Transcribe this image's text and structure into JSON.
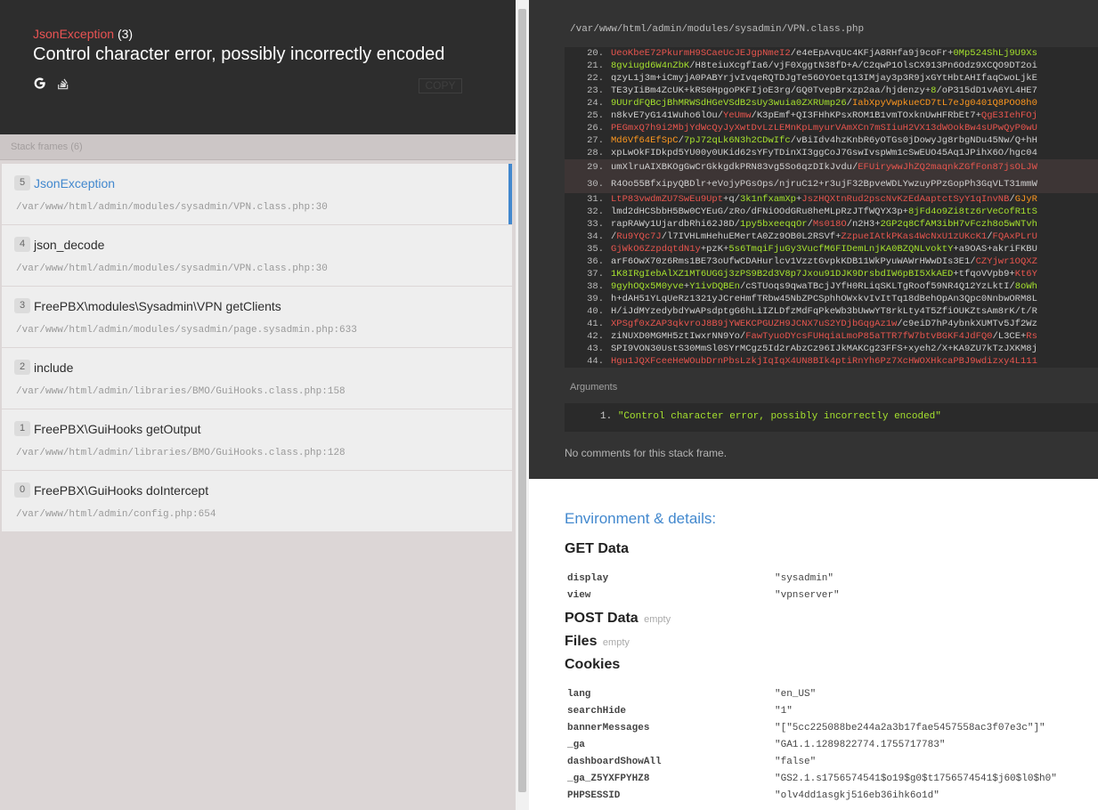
{
  "exception": {
    "name": "JsonException",
    "count": "(3)",
    "message": "Control character error, possibly incorrectly encoded",
    "copy_label": "COPY",
    "icons": [
      "google-icon",
      "stackoverflow-icon"
    ]
  },
  "frames_title": "Stack frames (6)",
  "frames": [
    {
      "index": "5",
      "name": "JsonException",
      "file": "/var/www/html/admin/modules/sysadmin/VPN.class.php:30"
    },
    {
      "index": "4",
      "name": "json_decode",
      "file": "/var/www/html/admin/modules/sysadmin/VPN.class.php:30"
    },
    {
      "index": "3",
      "name": "FreePBX\\modules\\Sysadmin\\VPN getClients",
      "file": "/var/www/html/admin/modules/sysadmin/page.sysadmin.php:633"
    },
    {
      "index": "2",
      "name": "include",
      "file": "/var/www/html/admin/libraries/BMO/GuiHooks.class.php:158"
    },
    {
      "index": "1",
      "name": "FreePBX\\GuiHooks getOutput",
      "file": "/var/www/html/admin/libraries/BMO/GuiHooks.class.php:128"
    },
    {
      "index": "0",
      "name": "FreePBX\\GuiHooks doIntercept",
      "file": "/var/www/html/admin/config.php:654"
    }
  ],
  "code": {
    "file_path": "/var/www/html/admin/modules/sysadmin/VPN.class.php",
    "lines": [
      {
        "n": "20.",
        "segs": [
          [
            "r",
            "UeoKbeE72PkurmH9SCaeUcJEJgpNmeI2"
          ],
          [
            "w",
            "/e4eEpAvqUc4KFjA8RHfa9j9coFr+"
          ],
          [
            "g",
            "0Mp524ShLj9U9Xs"
          ]
        ]
      },
      {
        "n": "21.",
        "segs": [
          [
            "g",
            "8gviugd6W4nZbK"
          ],
          [
            "w",
            "/H8teiuXcgfIa6/vjF0XggtN38fD+A/C2qwP1OlsCX913Pn6Odz9XCQO9DT2oi"
          ]
        ]
      },
      {
        "n": "22.",
        "segs": [
          [
            "w",
            "qzyL1j3m+iCmyjA0PABYrjvIvqeRQTDJgTe56OYOetq13IMjay3p3R9jxGYtHbtAHIfaqCwoLjkE"
          ]
        ]
      },
      {
        "n": "23.",
        "segs": [
          [
            "w",
            "TE3yIiBm4ZcUK+kRS0HpgoPKFIjoE3rg/GQ0TvepBrxzp2aa/hjdenzy+"
          ],
          [
            "g",
            "8"
          ],
          [
            "w",
            "/oP315dD1vA6YL4HE7"
          ]
        ]
      },
      {
        "n": "24.",
        "segs": [
          [
            "g",
            "9UUrdFQBcjBhMRWSdHGeVSdB2sUy3wuia0ZXRUmp26"
          ],
          [
            "w",
            "/"
          ],
          [
            "o",
            "IabXpyVwpkueCD7tL7eJg0401Q8POO8h0"
          ]
        ]
      },
      {
        "n": "25.",
        "segs": [
          [
            "w",
            "n8kvE7yG141Wuho6lOu/"
          ],
          [
            "r",
            "YeUmw"
          ],
          [
            "w",
            "/K3pEmf+QI3FHhKPsxROM1B1vmTOxknUwHFRbEt7+"
          ],
          [
            "r",
            "QgE3IehFOj"
          ]
        ]
      },
      {
        "n": "26.",
        "segs": [
          [
            "r",
            "PEGmxQ7h9i2MbjYdWcQyJyXwtDvLzLEMnKpLmyurVAmXCn7mSIiuH2VX13dWOokBw4sUPwQyP0wU"
          ]
        ]
      },
      {
        "n": "27.",
        "segs": [
          [
            "o",
            "Md6Vf64EfSpC"
          ],
          [
            "w",
            "/"
          ],
          [
            "g",
            "7pJ72qLk6N3h2CDwIfc"
          ],
          [
            "w",
            "/vBiIdv4hzKnbR6yOTGs0jDowyJg8rbgNDu45Nw/Q+hH"
          ]
        ]
      },
      {
        "n": "28.",
        "segs": [
          [
            "w",
            "xpLwOkFIDkpd5YU00y0UKid62sYFyTDinXI3ggCoJ7GswIvspWm1cSwEUO45Aq1JPihX6O/hgc04"
          ]
        ]
      },
      {
        "n": "29.",
        "hl": true,
        "segs": [
          [
            "w",
            "umXlruAIXBKOgGwCrGkkgdkPRN83vg5So6qzDIkJvdu/"
          ],
          [
            "r",
            "EFUirywwJhZQ2maqnkZGfFon87jsOLJW"
          ]
        ]
      },
      {
        "n": "30.",
        "hl": true,
        "segs": [
          [
            "w",
            "R4Oo55BfxipyQBDlr+eVojyPGsOps/njruC12+r3ujF32BpveWDLYwzuyPPzGopPh3GqVLT31mmW"
          ]
        ]
      },
      {
        "n": "31.",
        "segs": [
          [
            "r",
            "LtP83vwdmZU7SwEu9Upt"
          ],
          [
            "w",
            "+q/"
          ],
          [
            "g",
            "3k1nfxamXp"
          ],
          [
            "w",
            "+"
          ],
          [
            "r",
            "JszHQXtnRud2pscNvKzEdAaptctSyY1qInvNB"
          ],
          [
            "w",
            "/"
          ],
          [
            "o",
            "GJyR"
          ]
        ]
      },
      {
        "n": "32.",
        "segs": [
          [
            "w",
            "lmd2dHCSbbH5Bw0CYEuG/zRo/dFNiOOdGRu8heMLpRzJTfWQYX3p+"
          ],
          [
            "g",
            "8jFd4o9Zi8tz6rVeCofR1tS"
          ]
        ]
      },
      {
        "n": "33.",
        "segs": [
          [
            "w",
            "rapRAWy1UjardbRhi62J8D/"
          ],
          [
            "g",
            "1py5bxeeqqOr"
          ],
          [
            "w",
            "/"
          ],
          [
            "r",
            "Ms018O"
          ],
          [
            "w",
            "/n2H3+"
          ],
          [
            "g",
            "2GP2q8CfAM3ibH7vFczh8o5wNTvh"
          ]
        ]
      },
      {
        "n": "34.",
        "segs": [
          [
            "w",
            "/"
          ],
          [
            "r",
            "Ru9YQc7J"
          ],
          [
            "w",
            "/l7IVHLmHehuEMertA0Zz9OB0L2RSVf+"
          ],
          [
            "r",
            "ZzpueIAtkPKas4WcNxU1zUKcK1"
          ],
          [
            "w",
            "/"
          ],
          [
            "r",
            "FQAxPLrU"
          ]
        ]
      },
      {
        "n": "35.",
        "segs": [
          [
            "r",
            "GjWkO6ZzpdqtdN1y"
          ],
          [
            "w",
            "+pzK+"
          ],
          [
            "g",
            "5s6TmqiFjuGy3VucfM6FIDemLnjKA0BZQNLvoktY"
          ],
          [
            "w",
            "+a9OAS+akriFKBU"
          ]
        ]
      },
      {
        "n": "36.",
        "segs": [
          [
            "w",
            "arF6OwX70z6Rms1BE73oUfwCDAHurlcv1VzztGvpkKDB11WkPyuWAWrHWwDIs3E1/"
          ],
          [
            "r",
            "CZYjwr1OQXZ"
          ]
        ]
      },
      {
        "n": "37.",
        "segs": [
          [
            "g",
            "1K8IRgIebAlXZ1MT6UGGj3zPS9B2d3V8p7Jxou91DJK9DrsbdIW6pBI5XkAED"
          ],
          [
            "w",
            "+tfqoVVpb9+"
          ],
          [
            "r",
            "Kt6Y"
          ]
        ]
      },
      {
        "n": "38.",
        "segs": [
          [
            "g",
            "9gyhOQx5M0yve"
          ],
          [
            "w",
            "+"
          ],
          [
            "g",
            "Y1ivDQBEn"
          ],
          [
            "w",
            "/cSTUoqs9qwaTBcjJYfH0RLiqSKLTgRoof59NR4Q12YzLktI/"
          ],
          [
            "g",
            "8oWh"
          ]
        ]
      },
      {
        "n": "39.",
        "segs": [
          [
            "w",
            "h+dAH51YLqUeRz1321yJCreHmfTRbw45NbZPCSphhOWxkvIvItTq18dBehOpAn3Qpc0NnbwORM8L"
          ]
        ]
      },
      {
        "n": "40.",
        "segs": [
          [
            "w",
            "H/iJdMYzedybdYwAPsdptgG6hLiIZLDfzMdFqPkeWb3bUwwYT8rkLty4T5ZfiOUKZtsAm8rK/t/R"
          ]
        ]
      },
      {
        "n": "41.",
        "segs": [
          [
            "r",
            "XPSgf0xZAP3qkvroJ8B9jYWEKCPGUZH9JCNX7uS2YDjbGqgAz1w"
          ],
          [
            "w",
            "/c9eiD7hP4ybnkXUMTv5Jf2Wz"
          ]
        ]
      },
      {
        "n": "42.",
        "segs": [
          [
            "w",
            "ziNUXD0MGMH5ztIwxrNN9Yo/"
          ],
          [
            "r",
            "FawTyuoDYcsFUHqiaLmoP85aTTR7fW7btvBGKF4JdFQ0"
          ],
          [
            "w",
            "/L3CE+"
          ],
          [
            "r",
            "Rs"
          ]
        ]
      },
      {
        "n": "43.",
        "segs": [
          [
            "w",
            "SPI9VON30UstS30MmSl0SYrMCgz5Id2rAbzCz96IJkMAKCg23FFS+xyeh2/X+KA9ZU7kTzJXKM8j"
          ]
        ]
      },
      {
        "n": "44.",
        "segs": [
          [
            "r",
            "Hgu1JQXFceeHeWOubDrnPbsLzkjIqIqX4UN8BIk4ptiRnYh6Pz7XcHWOXHkcaPBJ9wdizxy4L111"
          ]
        ]
      }
    ]
  },
  "arguments_title": "Arguments",
  "arguments": [
    {
      "index": "1.",
      "value": "\"Control character error, possibly incorrectly encoded\""
    }
  ],
  "comments": "No comments for this stack frame.",
  "env": {
    "title": "Environment & details:",
    "get_title": "GET Data",
    "get": [
      {
        "k": "display",
        "v": "\"sysadmin\""
      },
      {
        "k": "view",
        "v": "\"vpnserver\""
      }
    ],
    "post_title": "POST Data",
    "post_empty": "empty",
    "files_title": "Files",
    "files_empty": "empty",
    "cookies_title": "Cookies",
    "cookies": [
      {
        "k": "lang",
        "v": "\"en_US\""
      },
      {
        "k": "searchHide",
        "v": "\"1\""
      },
      {
        "k": "bannerMessages",
        "v": "\"[\"5cc225088be244a2a3b17fae5457558ac3f07e3c\"]\""
      },
      {
        "k": "_ga",
        "v": "\"GA1.1.1289822774.1755717783\""
      },
      {
        "k": "dashboardShowAll",
        "v": "\"false\""
      },
      {
        "k": "_ga_Z5YXFPYHZ8",
        "v": "\"GS2.1.s1756574541$o19$g0$t1756574541$j60$l0$h0\""
      },
      {
        "k": "PHPSESSID",
        "v": "\"olv4dd1asgkj516eb36ihk6o1d\""
      }
    ]
  }
}
